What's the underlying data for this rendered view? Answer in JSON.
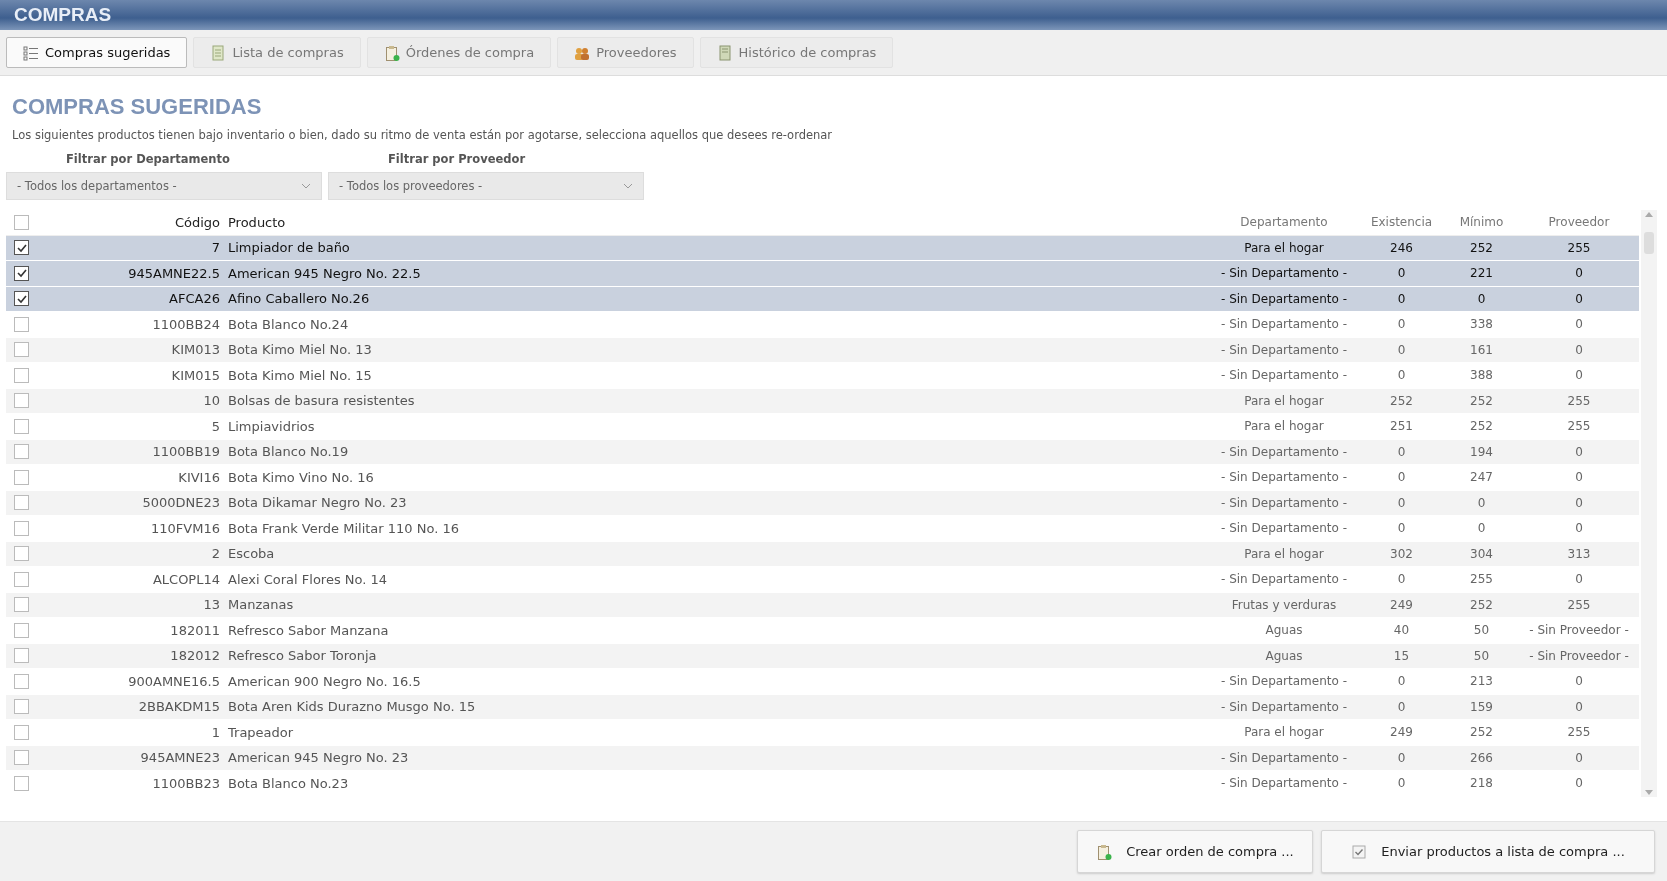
{
  "window": {
    "title": "COMPRAS"
  },
  "tabs": [
    {
      "label": "Compras sugeridas",
      "selected": true
    },
    {
      "label": "Lista de compras",
      "selected": false
    },
    {
      "label": "Órdenes de compra",
      "selected": false
    },
    {
      "label": "Proveedores",
      "selected": false
    },
    {
      "label": "Histórico de compras",
      "selected": false
    }
  ],
  "heading": "COMPRAS SUGERIDAS",
  "description": "Los siguientes productos tienen bajo inventario o bien, dado su ritmo de venta están por agotarse, selecciona aquellos que desees re-ordenar",
  "filters": [
    {
      "label": "Filtrar por Departamento",
      "value": "- Todos los departamentos -"
    },
    {
      "label": "Filtrar por Proveedor",
      "value": "- Todos los proveedores -"
    }
  ],
  "table": {
    "all_checked": false,
    "columns": [
      "Código",
      "Producto",
      "Departamento",
      "Existencia",
      "Mínimo",
      "Proveedor"
    ],
    "rows": [
      {
        "checked": true,
        "cells": [
          "7",
          "Limpiador de baño",
          "Para el hogar",
          "246",
          "252",
          "255"
        ]
      },
      {
        "checked": true,
        "cells": [
          "945AMNE22.5",
          "American 945 Negro No. 22.5",
          "- Sin Departamento -",
          "0",
          "221",
          "0"
        ]
      },
      {
        "checked": true,
        "cells": [
          "AFCA26",
          "Afino Caballero No.26",
          "- Sin Departamento -",
          "0",
          "0",
          "0"
        ]
      },
      {
        "checked": false,
        "cells": [
          "1100BB24",
          "Bota Blanco No.24",
          "- Sin Departamento -",
          "0",
          "338",
          "0"
        ]
      },
      {
        "checked": false,
        "cells": [
          "KIM013",
          "Bota Kimo Miel No. 13",
          "- Sin Departamento -",
          "0",
          "161",
          "0"
        ]
      },
      {
        "checked": false,
        "cells": [
          "KIM015",
          "Bota Kimo Miel No. 15",
          "- Sin Departamento -",
          "0",
          "388",
          "0"
        ]
      },
      {
        "checked": false,
        "cells": [
          "10",
          "Bolsas de basura resistentes",
          "Para el hogar",
          "252",
          "252",
          "255"
        ]
      },
      {
        "checked": false,
        "cells": [
          "5",
          "Limpiavidrios",
          "Para el hogar",
          "251",
          "252",
          "255"
        ]
      },
      {
        "checked": false,
        "cells": [
          "1100BB19",
          "Bota Blanco No.19",
          "- Sin Departamento -",
          "0",
          "194",
          "0"
        ]
      },
      {
        "checked": false,
        "cells": [
          "KIVI16",
          "Bota Kimo Vino No. 16",
          "- Sin Departamento -",
          "0",
          "247",
          "0"
        ]
      },
      {
        "checked": false,
        "cells": [
          "5000DNE23",
          "Bota Dikamar Negro No. 23",
          "- Sin Departamento -",
          "0",
          "0",
          "0"
        ]
      },
      {
        "checked": false,
        "cells": [
          "110FVM16",
          "Bota Frank Verde Militar 110 No. 16",
          "- Sin Departamento -",
          "0",
          "0",
          "0"
        ]
      },
      {
        "checked": false,
        "cells": [
          "2",
          "Escoba",
          "Para el hogar",
          "302",
          "304",
          "313"
        ]
      },
      {
        "checked": false,
        "cells": [
          "ALCOPL14",
          "Alexi Coral Flores No. 14",
          "- Sin Departamento -",
          "0",
          "255",
          "0"
        ]
      },
      {
        "checked": false,
        "cells": [
          "13",
          "Manzanas",
          "Frutas y verduras",
          "249",
          "252",
          "255"
        ]
      },
      {
        "checked": false,
        "cells": [
          "182011",
          "Refresco Sabor Manzana",
          "Aguas",
          "40",
          "50",
          "- Sin Proveedor -"
        ]
      },
      {
        "checked": false,
        "cells": [
          "182012",
          "Refresco Sabor Toronja",
          "Aguas",
          "15",
          "50",
          "- Sin Proveedor -"
        ]
      },
      {
        "checked": false,
        "cells": [
          "900AMNE16.5",
          "American 900 Negro No. 16.5",
          "- Sin Departamento -",
          "0",
          "213",
          "0"
        ]
      },
      {
        "checked": false,
        "cells": [
          "2BBAKDM15",
          "Bota Aren Kids Durazno Musgo No. 15",
          "- Sin Departamento -",
          "0",
          "159",
          "0"
        ]
      },
      {
        "checked": false,
        "cells": [
          "1",
          "Trapeador",
          "Para el hogar",
          "249",
          "252",
          "255"
        ]
      },
      {
        "checked": false,
        "cells": [
          "945AMNE23",
          "American 945 Negro No. 23",
          "- Sin Departamento -",
          "0",
          "266",
          "0"
        ]
      },
      {
        "checked": false,
        "cells": [
          "1100BB23",
          "Bota Blanco No.23",
          "- Sin Departamento -",
          "0",
          "218",
          "0"
        ]
      }
    ]
  },
  "buttons": [
    {
      "label": "Crear orden de compra ..."
    },
    {
      "label": "Enviar productos a lista de compra ..."
    }
  ]
}
